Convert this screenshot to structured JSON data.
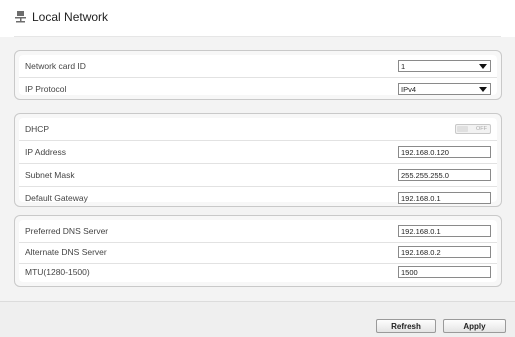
{
  "page": {
    "title": "Local Network"
  },
  "network_section": {
    "rows": [
      {
        "label": "Network card ID",
        "value": "1"
      },
      {
        "label": "IP Protocol",
        "value": "IPv4"
      }
    ]
  },
  "ip_section": {
    "dhcp": {
      "label": "DHCP",
      "state": "OFF"
    },
    "rows": [
      {
        "label": "IP Address",
        "value": "192.168.0.120"
      },
      {
        "label": "Subnet Mask",
        "value": "255.255.255.0"
      },
      {
        "label": "Default Gateway",
        "value": "192.168.0.1"
      }
    ]
  },
  "dns_section": {
    "rows": [
      {
        "label": "Preferred DNS Server",
        "value": "192.168.0.1"
      },
      {
        "label": "Alternate DNS Server",
        "value": "192.168.0.2"
      },
      {
        "label": "MTU(1280-1500)",
        "value": "1500"
      }
    ]
  },
  "buttons": {
    "refresh": "Refresh",
    "apply": "Apply"
  }
}
